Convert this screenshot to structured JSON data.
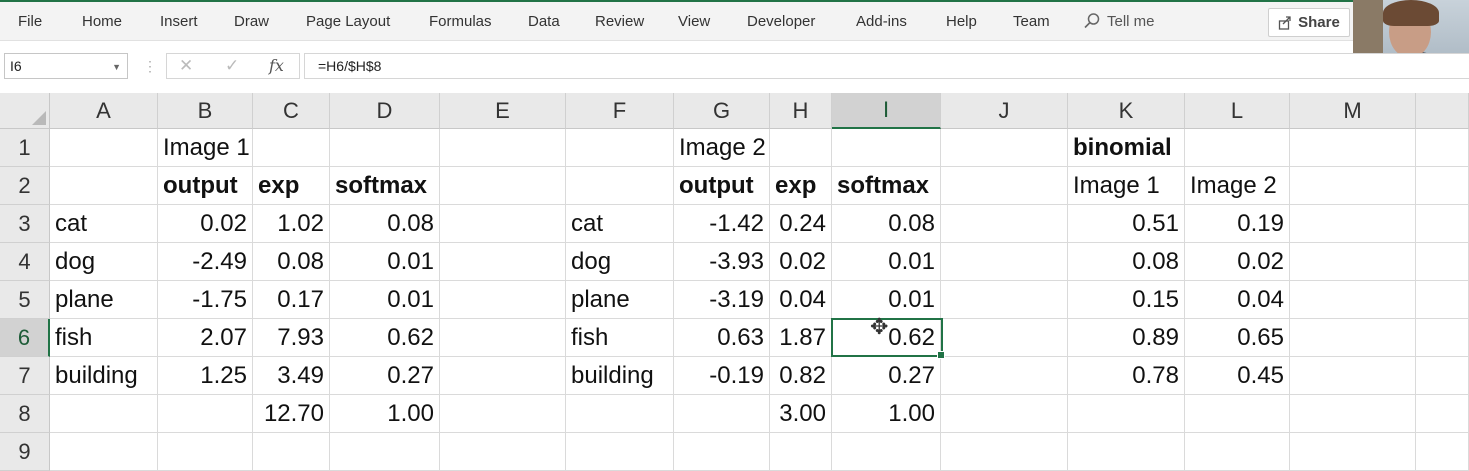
{
  "menu": [
    "File",
    "Home",
    "Insert",
    "Draw",
    "Page Layout",
    "Formulas",
    "Data",
    "Review",
    "View",
    "Developer",
    "Add-ins",
    "Help",
    "Team"
  ],
  "tellme": "Tell me",
  "share_label": "Share",
  "namebox": "I6",
  "formula": "=H6/$H$8",
  "accent_color": "#217346",
  "columns": [
    "A",
    "B",
    "C",
    "D",
    "E",
    "F",
    "G",
    "H",
    "I",
    "J",
    "K",
    "L",
    "M"
  ],
  "selected_column": "I",
  "rows": [
    "1",
    "2",
    "3",
    "4",
    "5",
    "6",
    "7",
    "8",
    "9"
  ],
  "selected_row": "6",
  "cells": {
    "B1": "Image 1",
    "G1": "Image 2",
    "K1": "binomial",
    "B2": "output",
    "C2": "exp",
    "D2": "softmax",
    "G2": "output",
    "H2": "exp",
    "I2": "softmax",
    "K2": "Image 1",
    "L2": "Image 2",
    "A3": "cat",
    "B3": "0.02",
    "C3": "1.02",
    "D3": "0.08",
    "F3": "cat",
    "G3": "-1.42",
    "H3": "0.24",
    "I3": "0.08",
    "K3": "0.51",
    "L3": "0.19",
    "A4": "dog",
    "B4": "-2.49",
    "C4": "0.08",
    "D4": "0.01",
    "F4": "dog",
    "G4": "-3.93",
    "H4": "0.02",
    "I4": "0.01",
    "K4": "0.08",
    "L4": "0.02",
    "A5": "plane",
    "B5": "-1.75",
    "C5": "0.17",
    "D5": "0.01",
    "F5": "plane",
    "G5": "-3.19",
    "H5": "0.04",
    "I5": "0.01",
    "K5": "0.15",
    "L5": "0.04",
    "A6": "fish",
    "B6": "2.07",
    "C6": "7.93",
    "D6": "0.62",
    "F6": "fish",
    "G6": "0.63",
    "H6": "1.87",
    "I6": "0.62",
    "K6": "0.89",
    "L6": "0.65",
    "A7": "building",
    "B7": "1.25",
    "C7": "3.49",
    "D7": "0.27",
    "F7": "building",
    "G7": "-0.19",
    "H7": "0.82",
    "I7": "0.27",
    "K7": "0.78",
    "L7": "0.45",
    "C8": "12.70",
    "D8": "1.00",
    "H8": "3.00",
    "I8": "1.00"
  },
  "bold_cells": [
    "K1",
    "B2",
    "C2",
    "D2",
    "G2",
    "H2",
    "I2"
  ],
  "active_cell": "I6"
}
